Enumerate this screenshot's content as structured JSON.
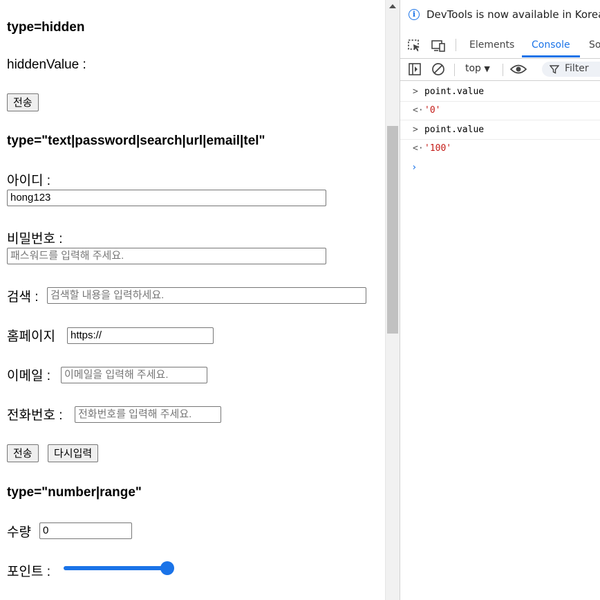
{
  "page": {
    "hidden_section": {
      "heading": "type=hidden",
      "hidden_label": "hiddenValue :",
      "submit_label": "전송"
    },
    "text_section": {
      "heading": "type=\"text|password|search|url|email|tel\"",
      "id_label": "아이디 :",
      "id_value": "hong123",
      "password_label": "비밀번호 :",
      "password_placeholder": "패스워드를 입력해 주세요.",
      "search_label": "검색 :",
      "search_placeholder": "검색할 내용을 입력하세요.",
      "homepage_label": "홈페이지",
      "homepage_value": "https://",
      "email_label": "이메일 :",
      "email_placeholder": "이메일을 입력해 주세요.",
      "tel_label": "전화번호 :",
      "tel_placeholder": "전화번호를 입력해 주세요.",
      "submit_label": "전송",
      "reset_label": "다시입력"
    },
    "number_section": {
      "heading": "type=\"number|range\"",
      "quantity_label": "수량",
      "quantity_value": "0",
      "point_label": "포인트 :",
      "point_range_fraction": 1.0
    }
  },
  "devtools": {
    "banner": "DevTools is now available in Korean!",
    "tabs": [
      "Elements",
      "Console",
      "So"
    ],
    "active_tab": "Console",
    "context": "top",
    "filter_label": "Filter",
    "console": [
      {
        "type": "input",
        "text": "point.value"
      },
      {
        "type": "output",
        "text": "'0'"
      },
      {
        "type": "input",
        "text": "point.value"
      },
      {
        "type": "output",
        "text": "'100'"
      }
    ],
    "accent_color": "#1a73e8",
    "string_color": "#c41a16"
  }
}
